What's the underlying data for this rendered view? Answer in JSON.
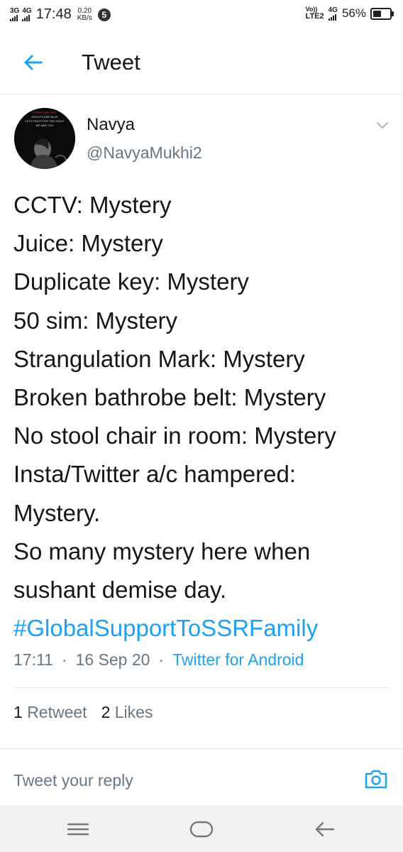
{
  "status_bar": {
    "network_1": "3G",
    "network_2": "4G",
    "time": "17:48",
    "speed_value": "0.20",
    "speed_unit": "KB/s",
    "notification_count": "5",
    "volte_top": "Vo))",
    "volte_bottom": "LTE2",
    "network_3": "4G",
    "battery": "56%",
    "battery_level": 0.56
  },
  "header": {
    "title": "Tweet",
    "back_icon": "arrow-left-icon",
    "accent_color": "#1da1f2"
  },
  "avatar_text": [
    "ROSES ARE RED",
    "VIOLETS ARE BLUE",
    "LETS FIGHT FOR THE RIGHT",
    "ME AND YOU"
  ],
  "tweet": {
    "display_name": "Navya",
    "handle": "@NavyaMukhi2",
    "lines": [
      "CCTV: Mystery",
      "Juice: Mystery",
      "Duplicate key: Mystery",
      "50 sim: Mystery",
      "Strangulation Mark: Mystery",
      "Broken bathrobe belt: Mystery",
      "No stool chair in room: Mystery",
      "Insta/Twitter a/c hampered:",
      "Mystery.",
      "So many mystery here when",
      "sushant demise day."
    ],
    "hashtag": "#GlobalSupportToSSRFamily",
    "time": "17:11",
    "date": "16 Sep 20",
    "separator": "·",
    "source": "Twitter for Android",
    "retweet_count": "1",
    "retweet_label": "Retweet",
    "like_count": "2",
    "like_label": "Likes"
  },
  "reply": {
    "placeholder": "Tweet your reply",
    "camera_icon": "camera-icon"
  },
  "nav": {
    "menu_icon": "menu-icon",
    "home_icon": "home-icon",
    "back_icon": "back-icon"
  }
}
